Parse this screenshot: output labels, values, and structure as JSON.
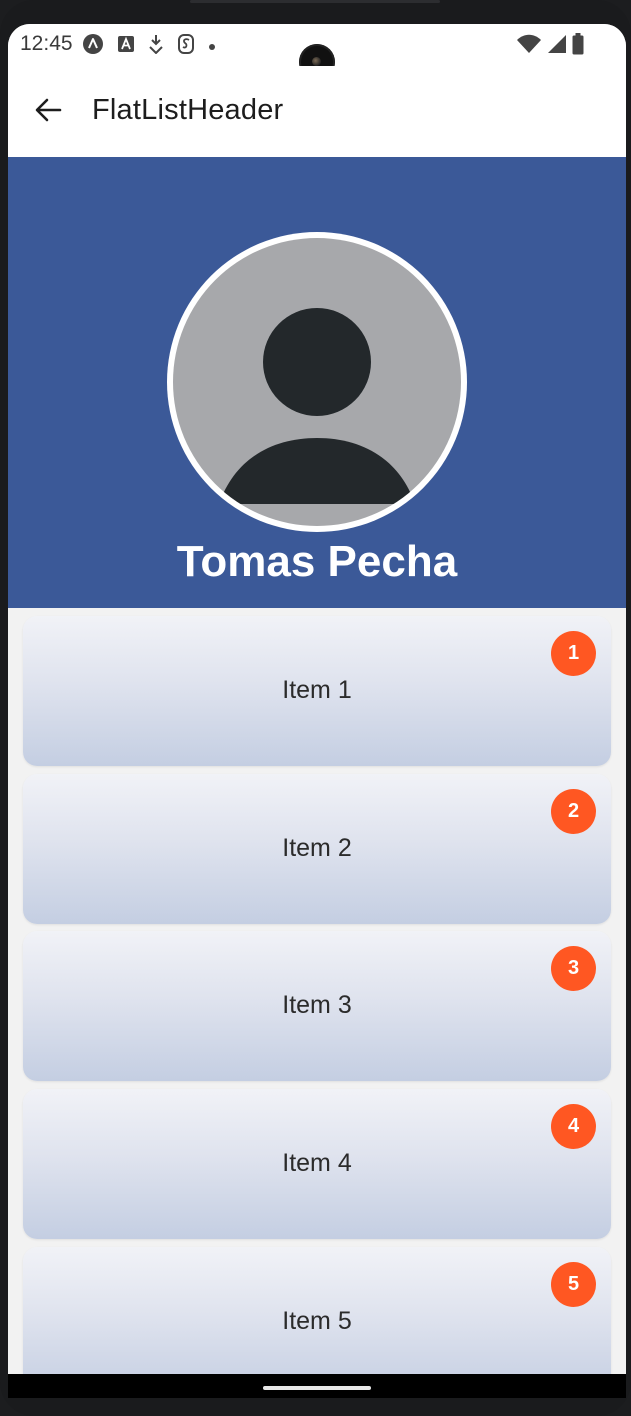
{
  "status_bar": {
    "time": "12:45",
    "left_icons": [
      "a-notification-icon",
      "a-box-notification-icon",
      "download-notification-icon",
      "s-notification-icon",
      "dot-notification-icon"
    ],
    "right_icons": [
      "wifi-icon",
      "cell-signal-icon",
      "battery-icon"
    ]
  },
  "app_bar": {
    "back_icon": "arrow-left-icon",
    "title": "FlatListHeader"
  },
  "profile": {
    "avatar_icon": "person-placeholder-icon",
    "name": "Tomas Pecha"
  },
  "list": {
    "items": [
      {
        "label": "Item 1",
        "badge": "1"
      },
      {
        "label": "Item 2",
        "badge": "2"
      },
      {
        "label": "Item 3",
        "badge": "3"
      },
      {
        "label": "Item 4",
        "badge": "4"
      },
      {
        "label": "Item 5",
        "badge": "5"
      }
    ]
  },
  "colors": {
    "header_background": "#3b5998",
    "badge": "#ff5722",
    "avatar_background": "#a7a8ab",
    "avatar_figure": "#23282b"
  }
}
